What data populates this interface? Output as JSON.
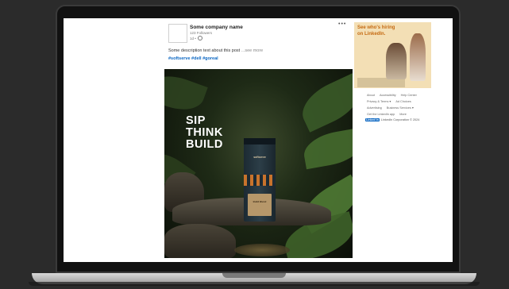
{
  "post": {
    "company_name": "Some company name",
    "followers": "123 Followers",
    "timestamp": "1d •",
    "more_label": "•••",
    "description": "Some description text about this post",
    "see_more": "...see more",
    "hashtags": "#softserve #dell #goreal",
    "image": {
      "headline": [
        "SIP",
        "THINK",
        "BUILD"
      ],
      "pack_brand": "softserve",
      "pack_label": "Build Blend"
    }
  },
  "sidebar": {
    "ad": {
      "text_lines": [
        "See who's hiring",
        "on LinkedIn."
      ]
    },
    "footer_links": [
      [
        "About",
        "Accessibility",
        "Help Center"
      ],
      [
        "Privacy & Terms ▾",
        "Ad Choices"
      ],
      [
        "Advertising",
        "Business Services ▾"
      ],
      [
        "Get the LinkedIn app",
        "More"
      ]
    ],
    "brand": {
      "logo": "Linked in",
      "copyright": "LinkedIn Corporation © 2024"
    }
  },
  "icons": {
    "globe": "globe-icon",
    "more": "more-icon",
    "linkedin": "linkedin-logo-icon"
  }
}
